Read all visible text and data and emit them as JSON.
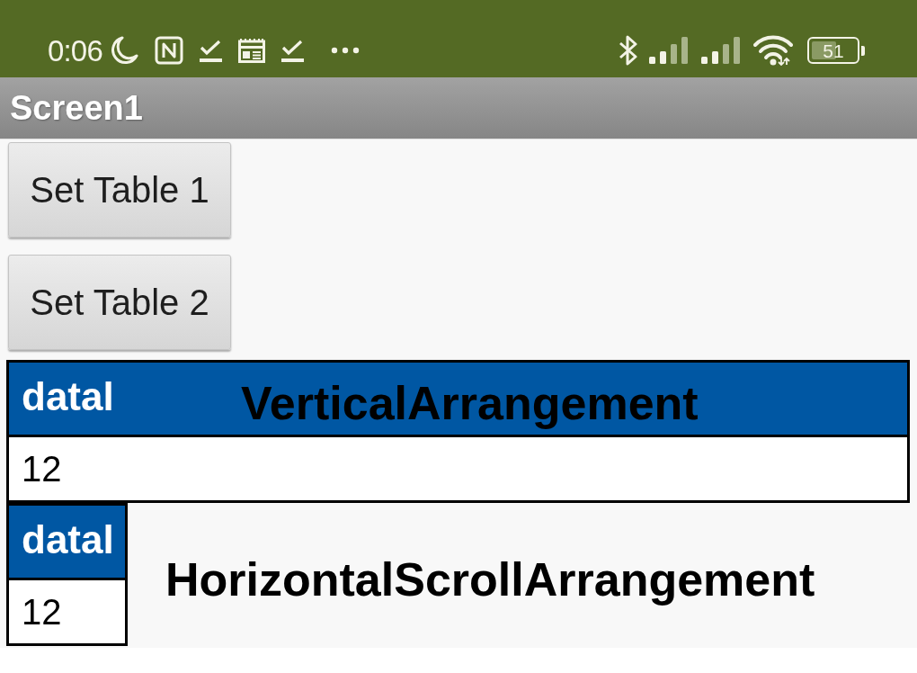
{
  "status_bar": {
    "time": "0:06",
    "battery": "51"
  },
  "title_bar": {
    "title": "Screen1"
  },
  "buttons": [
    "Set Table 1",
    "Set Table 2"
  ],
  "tables": [
    {
      "kind": "vertical",
      "columns": [
        "datal"
      ],
      "rows": [
        [
          "12"
        ]
      ],
      "annotation": "VerticalArrangement"
    },
    {
      "kind": "horizontal-scroll",
      "columns": [
        "datal"
      ],
      "rows": [
        [
          "12"
        ]
      ],
      "annotation": "HorizontalScrollArrangement"
    }
  ]
}
